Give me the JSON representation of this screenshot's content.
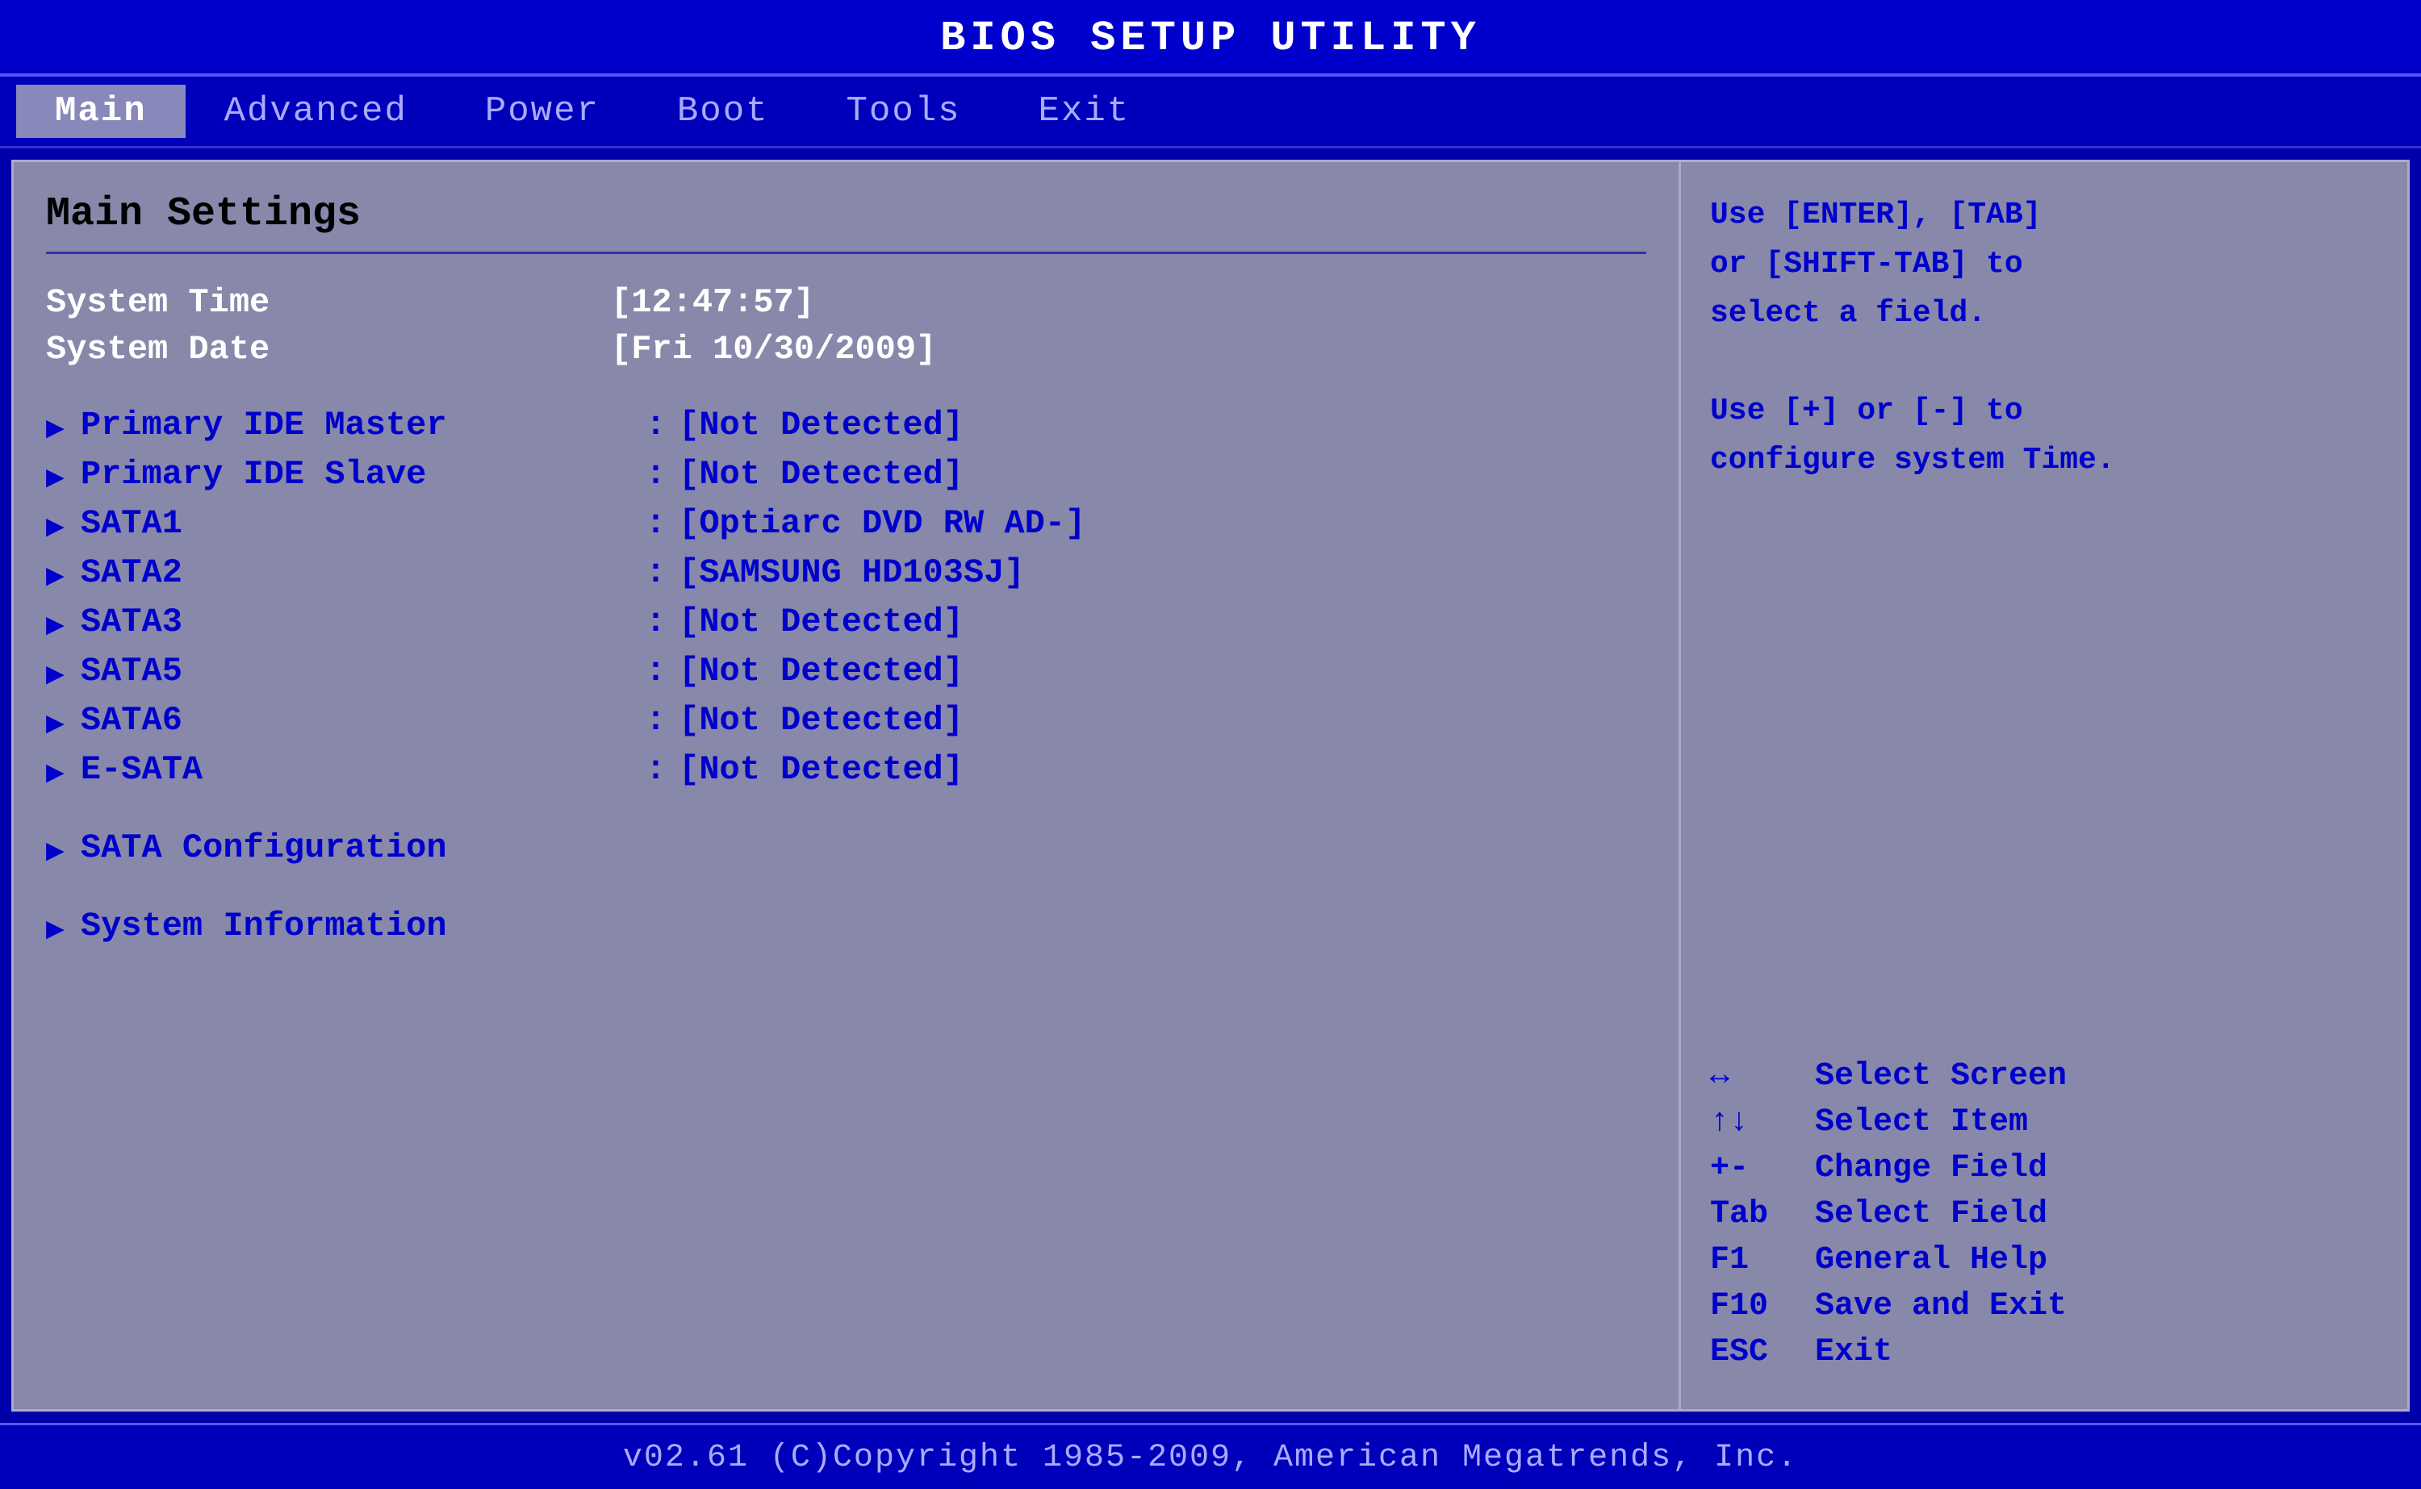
{
  "title": "BIOS SETUP UTILITY",
  "nav": {
    "items": [
      {
        "label": "Main",
        "active": true
      },
      {
        "label": "Advanced",
        "active": false
      },
      {
        "label": "Power",
        "active": false
      },
      {
        "label": "Boot",
        "active": false
      },
      {
        "label": "Tools",
        "active": false
      },
      {
        "label": "Exit",
        "active": false
      }
    ]
  },
  "main": {
    "section_title": "Main Settings",
    "settings": [
      {
        "type": "value",
        "label": "System Time",
        "value": "[12:47:57]",
        "highlight": true
      },
      {
        "type": "value",
        "label": "System Date",
        "value": "[Fri 10/30/2009]",
        "highlight": true
      },
      {
        "type": "submenu",
        "label": "Primary IDE Master",
        "value": "[Not Detected]"
      },
      {
        "type": "submenu",
        "label": "Primary IDE Slave",
        "value": "[Not Detected]"
      },
      {
        "type": "submenu",
        "label": "SATA1",
        "value": "[Optiarc DVD RW AD-]"
      },
      {
        "type": "submenu",
        "label": "SATA2",
        "value": "[SAMSUNG HD103SJ]"
      },
      {
        "type": "submenu",
        "label": "SATA3",
        "value": "[Not Detected]"
      },
      {
        "type": "submenu",
        "label": "SATA5",
        "value": "[Not Detected]"
      },
      {
        "type": "submenu",
        "label": "SATA6",
        "value": "[Not Detected]"
      },
      {
        "type": "submenu",
        "label": "E-SATA",
        "value": "[Not Detected]"
      },
      {
        "type": "submenu_only",
        "label": "SATA Configuration",
        "value": ""
      },
      {
        "type": "submenu_only",
        "label": "System Information",
        "value": ""
      }
    ]
  },
  "help": {
    "intro": "Use [ENTER], [TAB]\nor [SHIFT-TAB] to\nselect a field.\n\nUse [+] or [-] to\nconfigure system Time.",
    "keys": [
      {
        "symbol": "↔",
        "desc": "Select Screen"
      },
      {
        "symbol": "↑↓",
        "desc": "Select Item"
      },
      {
        "symbol": "+-",
        "desc": "Change Field"
      },
      {
        "symbol": "Tab",
        "desc": "Select Field"
      },
      {
        "symbol": "F1",
        "desc": "General Help"
      },
      {
        "symbol": "F10",
        "desc": "Save and Exit"
      },
      {
        "symbol": "ESC",
        "desc": "Exit"
      }
    ]
  },
  "footer": "v02.61  (C)Copyright 1985-2009, American Megatrends, Inc."
}
